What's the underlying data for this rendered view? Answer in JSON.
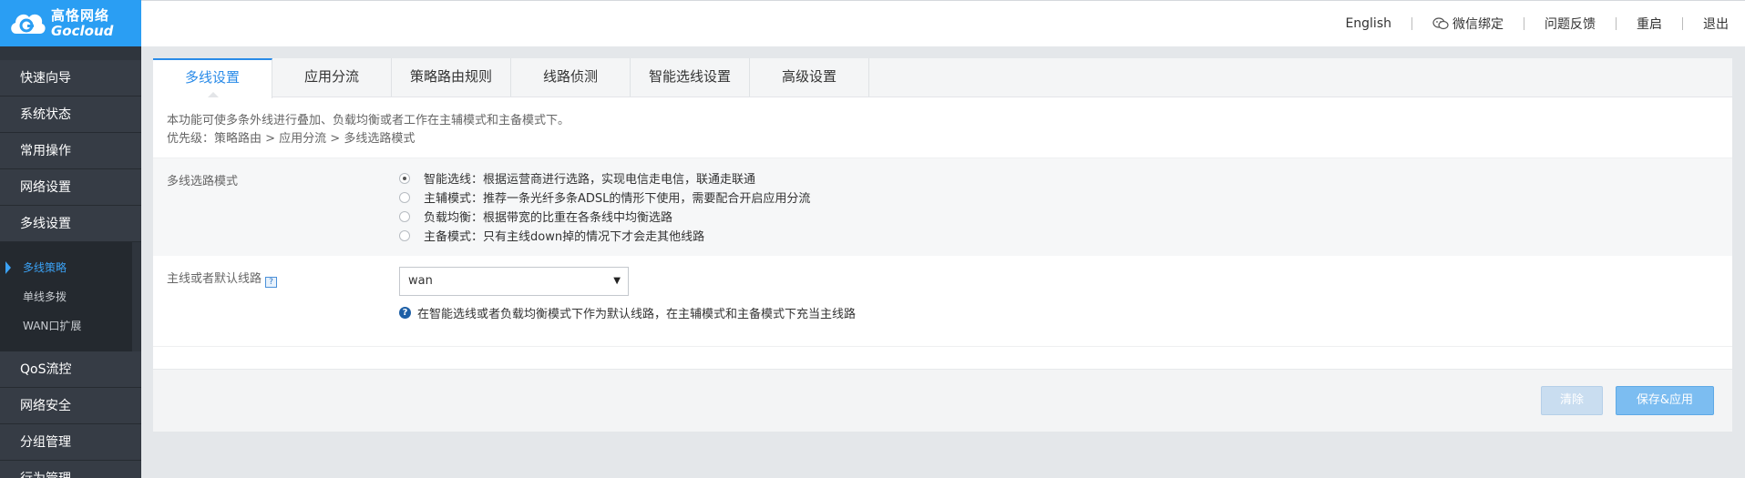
{
  "brand": {
    "name_cn": "高恪网络",
    "name_en": "Gocloud"
  },
  "header": {
    "links": [
      {
        "label": "English"
      },
      {
        "label": "微信绑定",
        "icon": "wechat-icon"
      },
      {
        "label": "问题反馈"
      },
      {
        "label": "重启"
      },
      {
        "label": "退出"
      }
    ]
  },
  "sidebar": {
    "items": [
      {
        "label": "快速向导"
      },
      {
        "label": "系统状态"
      },
      {
        "label": "常用操作"
      },
      {
        "label": "网络设置"
      },
      {
        "label": "多线设置"
      }
    ],
    "subitems": [
      {
        "label": "多线策略",
        "active": true
      },
      {
        "label": "单线多拨"
      },
      {
        "label": "WAN口扩展"
      }
    ],
    "items_after": [
      {
        "label": "QoS流控"
      },
      {
        "label": "网络安全"
      },
      {
        "label": "分组管理"
      },
      {
        "label": "行为管理"
      }
    ]
  },
  "tabs": [
    {
      "label": "多线设置",
      "active": true
    },
    {
      "label": "应用分流"
    },
    {
      "label": "策略路由规则"
    },
    {
      "label": "线路侦测"
    },
    {
      "label": "智能选线设置"
    },
    {
      "label": "高级设置"
    }
  ],
  "description": {
    "line1": "本功能可使多条外线进行叠加、负载均衡或者工作在主辅模式和主备模式下。",
    "line2": "优先级：策略路由 > 应用分流 > 多线选路模式"
  },
  "mode": {
    "label": "多线选路模式",
    "options": [
      {
        "label": "智能选线：根据运营商进行选路，实现电信走电信，联通走联通",
        "checked": true
      },
      {
        "label": "主辅模式：推荐一条光纤多条ADSL的情形下使用，需要配合开启应用分流",
        "checked": false
      },
      {
        "label": "负载均衡：根据带宽的比重在各条线中均衡选路",
        "checked": false
      },
      {
        "label": "主备模式：只有主线down掉的情况下才会走其他线路",
        "checked": false
      }
    ]
  },
  "default_line": {
    "label": "主线或者默认线路",
    "value": "wan",
    "hint": "在智能选线或者负载均衡模式下作为默认线路，在主辅模式和主备模式下充当主线路"
  },
  "buttons": {
    "clear": "清除",
    "save": "保存&应用"
  },
  "colors": {
    "accent": "#2a8be8",
    "logo_bg": "#2a9ef3",
    "sidebar_bg": "#2f353d"
  }
}
